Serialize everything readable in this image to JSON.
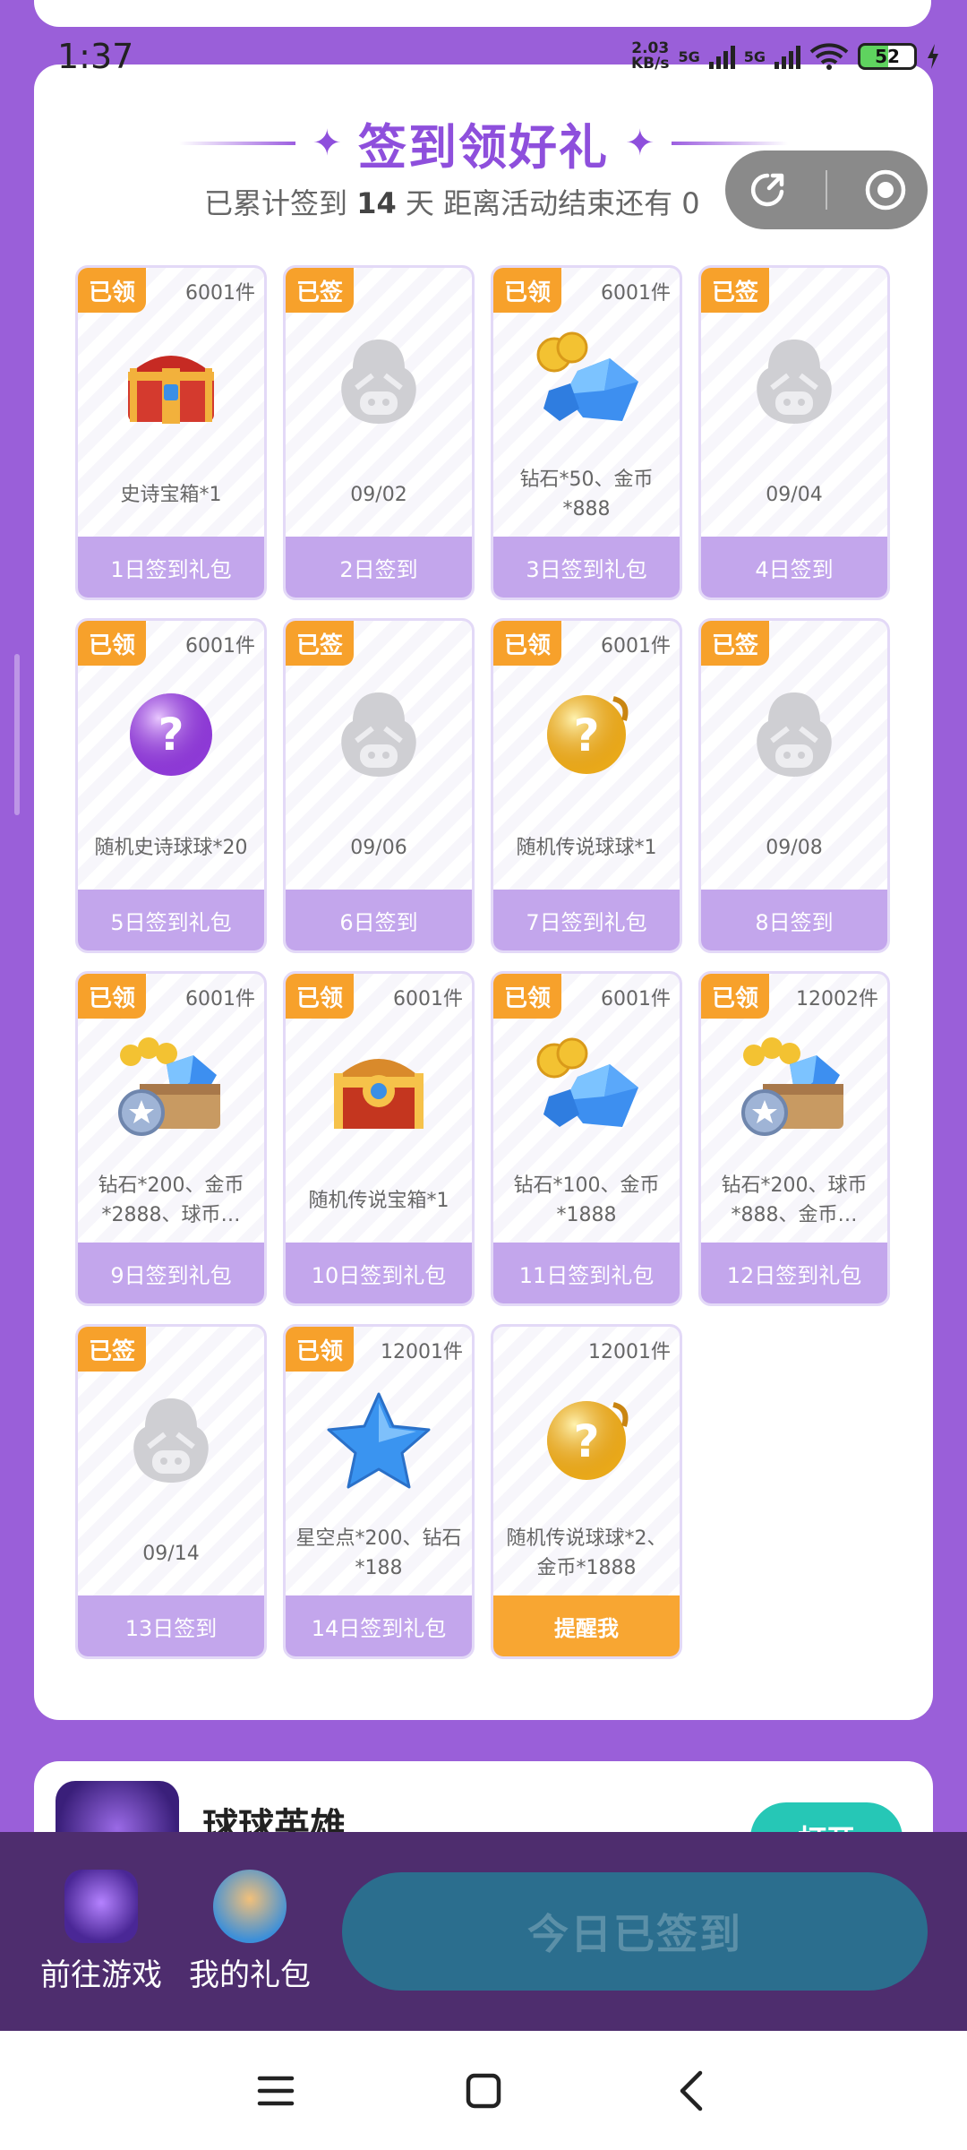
{
  "status_bar": {
    "time": "1:37",
    "net_speed_value": "2.03",
    "net_speed_unit": "KB/s",
    "signal1": "5G",
    "signal2": "5G",
    "battery": "52"
  },
  "header": {
    "title": "签到领好礼",
    "subtitle_prefix": "已累计签到",
    "days": "14",
    "subtitle_mid": "天   距离活动结束还有 0"
  },
  "cards": [
    {
      "badge": "已领",
      "count": "6001件",
      "desc": "史诗宝箱*1",
      "footer": "1日签到礼包",
      "icon": "chest-red-icon"
    },
    {
      "badge": "已签",
      "count": "",
      "desc": "09/02",
      "footer": "2日签到",
      "icon": "placeholder-avatar-icon"
    },
    {
      "badge": "已领",
      "count": "6001件",
      "desc": "钻石*50、金币*888",
      "footer": "3日签到礼包",
      "icon": "diamond-coin-icon"
    },
    {
      "badge": "已签",
      "count": "",
      "desc": "09/04",
      "footer": "4日签到",
      "icon": "placeholder-avatar-icon"
    },
    {
      "badge": "已领",
      "count": "6001件",
      "desc": "随机史诗球球*20",
      "footer": "5日签到礼包",
      "icon": "purple-mystery-ball-icon"
    },
    {
      "badge": "已签",
      "count": "",
      "desc": "09/06",
      "footer": "6日签到",
      "icon": "placeholder-avatar-icon"
    },
    {
      "badge": "已领",
      "count": "6001件",
      "desc": "随机传说球球*1",
      "footer": "7日签到礼包",
      "icon": "gold-mystery-ball-icon"
    },
    {
      "badge": "已签",
      "count": "",
      "desc": "09/08",
      "footer": "8日签到",
      "icon": "placeholder-avatar-icon"
    },
    {
      "badge": "已领",
      "count": "6001件",
      "desc": "钻石*200、金币*2888、球币…",
      "footer": "9日签到礼包",
      "icon": "treasure-box-icon"
    },
    {
      "badge": "已领",
      "count": "6001件",
      "desc": "随机传说宝箱*1",
      "footer": "10日签到礼包",
      "icon": "chest-gold-icon"
    },
    {
      "badge": "已领",
      "count": "6001件",
      "desc": "钻石*100、金币*1888",
      "footer": "11日签到礼包",
      "icon": "diamond-coin-icon"
    },
    {
      "badge": "已领",
      "count": "12002件",
      "desc": "钻石*200、球币*888、金币…",
      "footer": "12日签到礼包",
      "icon": "treasure-box-icon"
    },
    {
      "badge": "已签",
      "count": "",
      "desc": "09/14",
      "footer": "13日签到",
      "icon": "placeholder-avatar-icon"
    },
    {
      "badge": "已领",
      "count": "12001件",
      "desc": "星空点*200、钻石*188",
      "footer": "14日签到礼包",
      "icon": "blue-star-icon"
    },
    {
      "badge": "",
      "count": "12001件",
      "desc": "随机传说球球*2、金币*1888",
      "footer": "提醒我",
      "icon": "gold-mystery-ball-icon",
      "highlight": true
    }
  ],
  "game": {
    "name": "球球英雄",
    "open_label": "打开"
  },
  "bottom_bar": {
    "goto_game": "前往游戏",
    "my_gifts": "我的礼包",
    "signed_today": "今日已签到"
  },
  "colors": {
    "background": "#9a5fd9",
    "accent_purple": "#8e4fdc",
    "badge_orange": "#f7a12b",
    "footer_lilac": "#c3a6ec",
    "signed_button": "#2b6e8e"
  }
}
